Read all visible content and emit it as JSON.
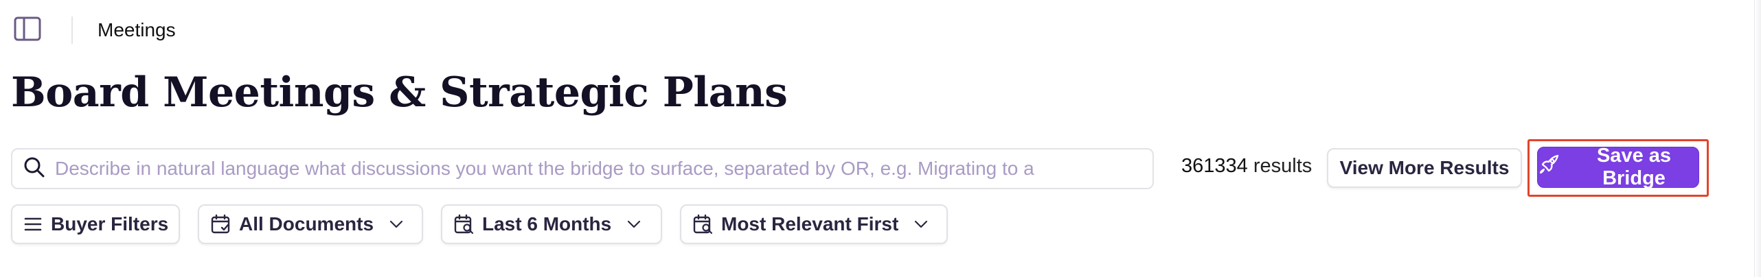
{
  "header": {
    "breadcrumb": "Meetings",
    "sidebar_toggle_icon": "sidebar-toggle-icon"
  },
  "page": {
    "title": "Board Meetings & Strategic Plans"
  },
  "search": {
    "placeholder": "Describe in natural language what discussions you want the bridge to surface, separated by OR, e.g. Migrating to a",
    "value": "",
    "icon": "search-icon"
  },
  "results": {
    "count": "361334",
    "label": "results"
  },
  "actions": {
    "view_more_label": "View More Results",
    "save_bridge_label": "Save as Bridge",
    "save_bridge_icon": "rocket-icon"
  },
  "filters": {
    "buyer": {
      "label": "Buyer Filters",
      "icon": "menu-lines-icon"
    },
    "documents": {
      "label": "All Documents",
      "icon": "calendar-check-icon"
    },
    "date_range": {
      "label": "Last 6 Months",
      "icon": "calendar-search-icon"
    },
    "sort": {
      "label": "Most Relevant First",
      "icon": "calendar-search-icon"
    }
  },
  "colors": {
    "accent": "#7b3fe4",
    "highlight": "#e2442b",
    "placeholder": "#a99bc4",
    "title": "#141025"
  }
}
